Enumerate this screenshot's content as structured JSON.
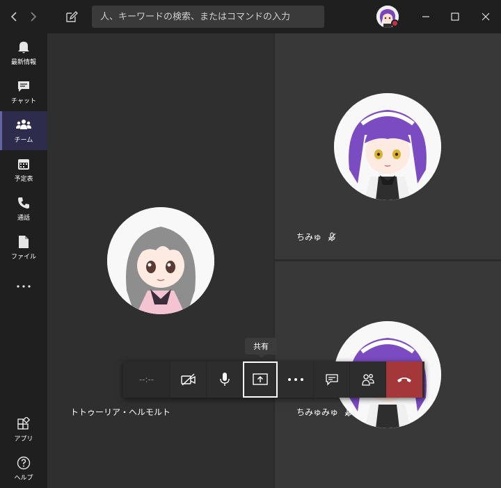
{
  "search": {
    "placeholder": "人、キーワードの検索、またはコマンドの入力"
  },
  "rail": {
    "items": [
      {
        "label": "最新情報"
      },
      {
        "label": "チャット"
      },
      {
        "label": "チーム"
      },
      {
        "label": "予定表"
      },
      {
        "label": "通話"
      },
      {
        "label": "ファイル"
      },
      {
        "label": "アプリ"
      },
      {
        "label": "ヘルプ"
      }
    ]
  },
  "meeting": {
    "participants": [
      {
        "name": "トトゥーリア・ヘルモルト"
      },
      {
        "name": "ちみゅ"
      },
      {
        "name": "ちみゅみゅ"
      }
    ],
    "timer": "--:--",
    "tooltip": "共有"
  },
  "colors": {
    "accent": "#6264a7",
    "hangup": "#a4373a",
    "presence_busy": "#c4314b"
  }
}
